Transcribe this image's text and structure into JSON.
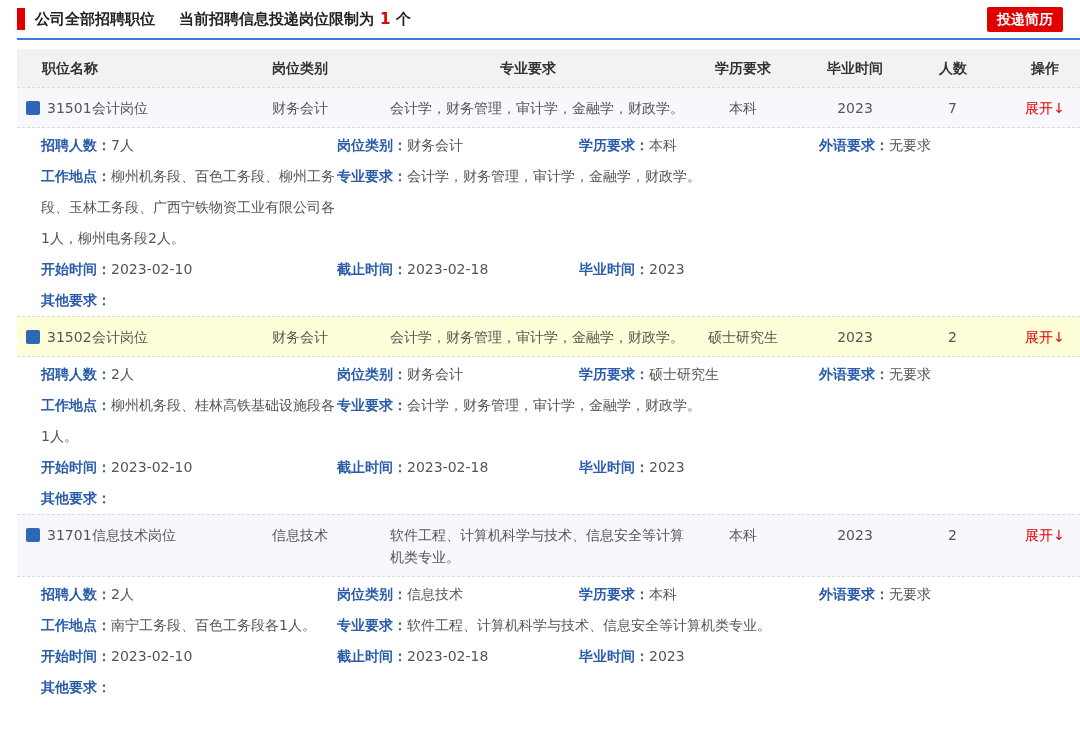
{
  "header": {
    "title": "公司全部招聘职位",
    "notice_prefix": "当前招聘信息投递岗位限制为",
    "limit": "1",
    "notice_suffix": "个",
    "button": "投递简历"
  },
  "table": {
    "columns": [
      "职位名称",
      "岗位类别",
      "专业要求",
      "学历要求",
      "毕业时间",
      "人数",
      "操作"
    ],
    "rows": [
      {
        "highlighted": false,
        "name": "31501会计岗位",
        "category": "财务会计",
        "major": "会计学，财务管理，审计学，金融学，财政学。",
        "education": "本科",
        "graduation": "2023",
        "count": "7",
        "action": "展开↓",
        "details": [
          [
            {
              "label": "招聘人数：",
              "value": "7人"
            },
            {
              "label": "岗位类别：",
              "value": "财务会计"
            },
            {
              "label": "学历要求：",
              "value": "本科"
            },
            {
              "label": "外语要求：",
              "value": "无要求"
            }
          ],
          [
            {
              "label": "工作地点：",
              "value": "柳州机务段、百色工务段、柳州工务段、玉林工务段、广西宁铁物资工业有限公司各1人，柳州电务段2人。"
            },
            {
              "label": "专业要求：",
              "value": "会计学，财务管理，审计学，金融学，财政学。",
              "kind": "wide"
            }
          ],
          [
            {
              "label": "开始时间：",
              "value": "2023-02-10"
            },
            {
              "label": "截止时间：",
              "value": "2023-02-18"
            },
            {
              "label": "毕业时间：",
              "value": "2023"
            }
          ],
          [
            {
              "label": "其他要求："
            }
          ]
        ]
      },
      {
        "highlighted": true,
        "name": "31502会计岗位",
        "category": "财务会计",
        "major": "会计学，财务管理，审计学，金融学，财政学。",
        "education": "硕士研究生",
        "graduation": "2023",
        "count": "2",
        "action": "展开↓",
        "details": [
          [
            {
              "label": "招聘人数：",
              "value": "2人"
            },
            {
              "label": "岗位类别：",
              "value": "财务会计"
            },
            {
              "label": "学历要求：",
              "value": "硕士研究生"
            },
            {
              "label": "外语要求：",
              "value": "无要求"
            }
          ],
          [
            {
              "label": "工作地点：",
              "value": "柳州机务段、桂林高铁基础设施段各1人。"
            },
            {
              "label": "专业要求：",
              "value": "会计学，财务管理，审计学，金融学，财政学。",
              "kind": "wide"
            }
          ],
          [
            {
              "label": "开始时间：",
              "value": "2023-02-10"
            },
            {
              "label": "截止时间：",
              "value": "2023-02-18"
            },
            {
              "label": "毕业时间：",
              "value": "2023"
            }
          ],
          [
            {
              "label": "其他要求："
            }
          ]
        ]
      },
      {
        "highlighted": false,
        "name": "31701信息技术岗位",
        "category": "信息技术",
        "major": "软件工程、计算机科学与技术、信息安全等计算机类专业。",
        "education": "本科",
        "graduation": "2023",
        "count": "2",
        "action": "展开↓",
        "details": [
          [
            {
              "label": "招聘人数：",
              "value": "2人"
            },
            {
              "label": "岗位类别：",
              "value": "信息技术"
            },
            {
              "label": "学历要求：",
              "value": "本科"
            },
            {
              "label": "外语要求：",
              "value": "无要求"
            }
          ],
          [
            {
              "label": "工作地点：",
              "value": "南宁工务段、百色工务段各1人。"
            },
            {
              "label": "专业要求：",
              "value": "软件工程、计算机科学与技术、信息安全等计算机类专业。",
              "kind": "wide"
            }
          ],
          [
            {
              "label": "开始时间：",
              "value": "2023-02-10"
            },
            {
              "label": "截止时间：",
              "value": "2023-02-18"
            },
            {
              "label": "毕业时间：",
              "value": "2023"
            }
          ],
          [
            {
              "label": "其他要求："
            }
          ]
        ]
      }
    ]
  }
}
